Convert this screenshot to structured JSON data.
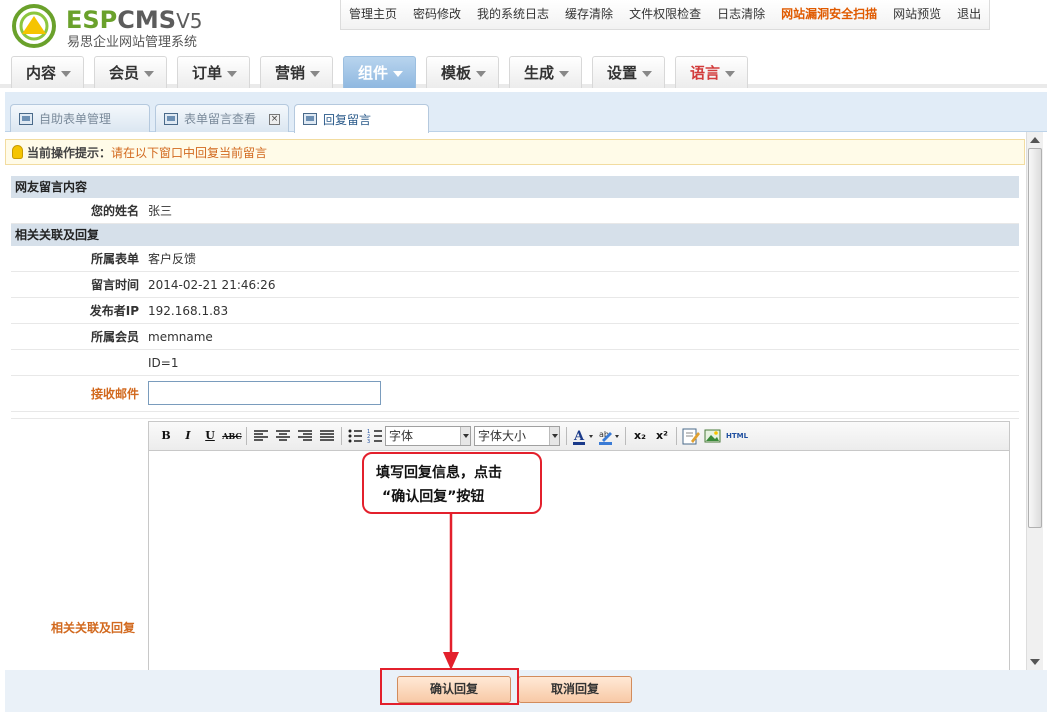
{
  "app": {
    "logo_esp": "ESP",
    "logo_cms": "CMS",
    "logo_v5": "V5",
    "subtitle": "易思企业网站管理系统"
  },
  "topnav": [
    {
      "label": "管理主页"
    },
    {
      "label": "密码修改"
    },
    {
      "label": "我的系统日志"
    },
    {
      "label": "缓存清除"
    },
    {
      "label": "文件权限检查"
    },
    {
      "label": "日志清除"
    },
    {
      "label": "网站漏洞安全扫描",
      "highlight": true
    },
    {
      "label": "网站预览"
    },
    {
      "label": "退出"
    }
  ],
  "menu": [
    {
      "label": "内容"
    },
    {
      "label": "会员"
    },
    {
      "label": "订单"
    },
    {
      "label": "营销"
    },
    {
      "label": "组件",
      "active": true
    },
    {
      "label": "模板"
    },
    {
      "label": "生成"
    },
    {
      "label": "设置"
    },
    {
      "label": "语言",
      "red": true
    }
  ],
  "subtabs": [
    {
      "label": "自助表单管理"
    },
    {
      "label": "表单留言查看",
      "closable": true
    },
    {
      "label": "回复留言",
      "active": true
    }
  ],
  "hint": {
    "title": "当前操作提示：",
    "text": "请在以下窗口中回复当前留言",
    "icon": "lightbulb-icon"
  },
  "section1": {
    "title": "网友留言内容",
    "name_label": "您的姓名",
    "name_value": "张三"
  },
  "section2": {
    "title": "相关关联及回复",
    "form_label": "所属表单",
    "form_value": "客户反馈",
    "time_label": "留言时间",
    "time_value": "2014-02-21 21:46:26",
    "ip_label": "发布者IP",
    "ip_value": "192.168.1.83",
    "member_label": "所属会员",
    "member_value": "memname",
    "id_value": "ID=1",
    "email_label": "接收邮件",
    "email_value": "",
    "reply_label": "相关关联及回复"
  },
  "editor": {
    "bold": "B",
    "italic": "I",
    "underline": "U",
    "strike": "ABC",
    "font_select": "字体",
    "size_select": "字体大小",
    "html_label": "HTML",
    "sub": "x₂",
    "sup": "x²"
  },
  "buttons": {
    "confirm": "确认回复",
    "cancel": "取消回复"
  },
  "annotation": {
    "line1": "填写回复信息，点击",
    "line2": "“确认回复”按钮"
  },
  "colors": {
    "accent_orange": "#d2691e",
    "annotation_red": "#e3202c",
    "logo_green": "#6aa12b"
  }
}
